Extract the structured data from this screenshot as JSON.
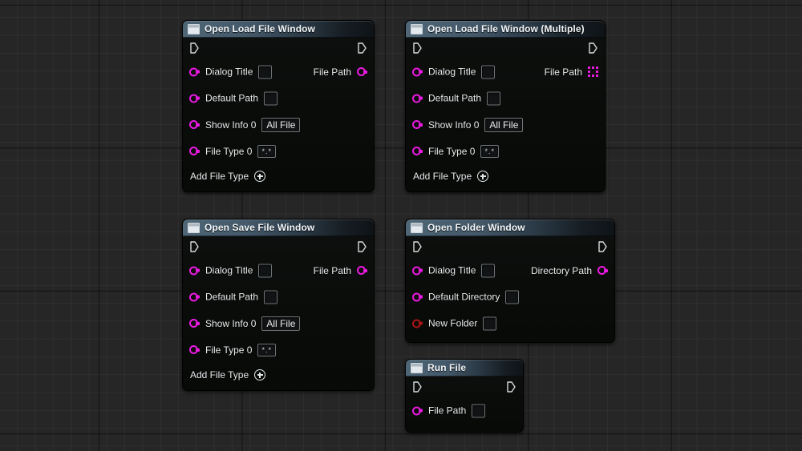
{
  "graph": {
    "app": "Blueprint Graph Editor",
    "background": "#262626",
    "grid_line_color": "#303030",
    "colors": {
      "string_pin": "#ea1ae0",
      "bool_pin": "#a81414",
      "exec_pin": "#ffffff",
      "title_bar": "#4e6676",
      "node_body": "#0b0d0b"
    }
  },
  "nodes": [
    {
      "title": "Open Load File Window",
      "icon": "window-icon",
      "exec_in": "exec-in",
      "exec_out": "exec-out",
      "inputs": [
        {
          "label": "Dialog Title",
          "pin": "string",
          "widget": "empty-text"
        },
        {
          "label": "Default Path",
          "pin": "string",
          "widget": "empty-text"
        },
        {
          "label": "Show Info 0",
          "pin": "string",
          "widget": "text",
          "value": "All File"
        },
        {
          "label": "File Type 0",
          "pin": "string",
          "widget": "tiny-text",
          "value": "*.*"
        }
      ],
      "outputs": [
        {
          "label": "File Path",
          "pin": "string"
        }
      ],
      "add_button": "Add File Type"
    },
    {
      "title": "Open Load File Window (Multiple)",
      "icon": "window-icon",
      "exec_in": "exec-in",
      "exec_out": "exec-out",
      "inputs": [
        {
          "label": "Dialog Title",
          "pin": "string",
          "widget": "empty-text"
        },
        {
          "label": "Default Path",
          "pin": "string",
          "widget": "empty-text"
        },
        {
          "label": "Show Info 0",
          "pin": "string",
          "widget": "text",
          "value": "All File"
        },
        {
          "label": "File Type 0",
          "pin": "string",
          "widget": "tiny-text",
          "value": "*.*"
        }
      ],
      "outputs": [
        {
          "label": "File Path",
          "pin": "string-array"
        }
      ],
      "add_button": "Add File Type"
    },
    {
      "title": "Open Save File Window",
      "icon": "window-icon",
      "exec_in": "exec-in",
      "exec_out": "exec-out",
      "inputs": [
        {
          "label": "Dialog Title",
          "pin": "string",
          "widget": "empty-text"
        },
        {
          "label": "Default Path",
          "pin": "string",
          "widget": "empty-text"
        },
        {
          "label": "Show Info 0",
          "pin": "string",
          "widget": "text",
          "value": "All File"
        },
        {
          "label": "File Type 0",
          "pin": "string",
          "widget": "tiny-text",
          "value": "*.*"
        }
      ],
      "outputs": [
        {
          "label": "File Path",
          "pin": "string"
        }
      ],
      "add_button": "Add File Type"
    },
    {
      "title": "Open Folder Window",
      "icon": "window-icon",
      "exec_in": "exec-in",
      "exec_out": "exec-out",
      "inputs": [
        {
          "label": "Dialog Title",
          "pin": "string",
          "widget": "empty-text"
        },
        {
          "label": "Default Directory",
          "pin": "string",
          "widget": "empty-text"
        },
        {
          "label": "New Folder",
          "pin": "bool",
          "widget": "checkbox"
        }
      ],
      "outputs": [
        {
          "label": "Directory Path",
          "pin": "string"
        }
      ],
      "add_button": null
    },
    {
      "title": "Run File",
      "icon": "window-icon",
      "exec_in": "exec-in",
      "exec_out": "exec-out",
      "inputs": [
        {
          "label": "File Path",
          "pin": "string",
          "widget": "empty-text"
        }
      ],
      "outputs": [],
      "add_button": null
    }
  ]
}
